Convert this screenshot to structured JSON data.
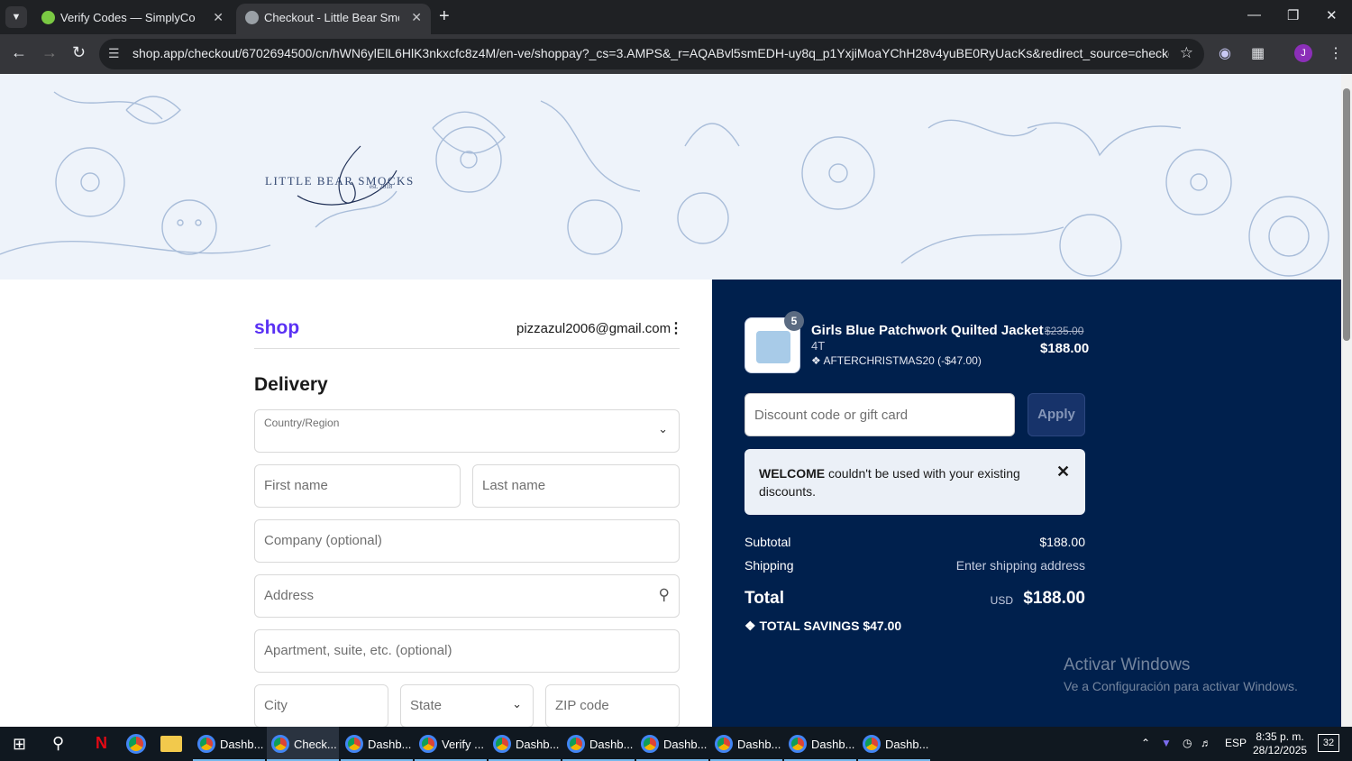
{
  "browser": {
    "tabs": [
      {
        "title": "Verify Codes — SimplyCodes",
        "active": false
      },
      {
        "title": "Checkout - Little Bear Smocks",
        "active": true
      }
    ],
    "url": "shop.app/checkout/6702694500/cn/hWN6ylElL6HlK3nkxcfc8z4M/en-ve/shoppay?_cs=3.AMPS&_r=AQABvl5smEDH-uy8q_p1YxjiMoaYChH28v4yuBE0RyUacKs&redirect_source=checkout_automatic...",
    "avatar_initial": "J"
  },
  "store": {
    "logo_text": "LITTLE BEAR SMOCKS",
    "logo_est": "est. 2018"
  },
  "checkout": {
    "shop_logo": "shop",
    "email": "pizzazul2006@gmail.com",
    "section_title": "Delivery",
    "fields": {
      "country": "Country/Region",
      "first_name": "First name",
      "last_name": "Last name",
      "company": "Company (optional)",
      "address": "Address",
      "apartment": "Apartment, suite, etc. (optional)",
      "city": "City",
      "state": "State",
      "zip": "ZIP code"
    }
  },
  "summary": {
    "item": {
      "quantity": "5",
      "name": "Girls Blue Patchwork Quilted Jacket",
      "variant": "4T",
      "discount": "AFTERCHRISTMAS20 (-$47.00)",
      "price_original": "$235.00",
      "price": "$188.00"
    },
    "discount_placeholder": "Discount code or gift card",
    "apply_label": "Apply",
    "notice": {
      "code": "WELCOME",
      "message": " couldn't be used with your existing discounts."
    },
    "subtotal_label": "Subtotal",
    "subtotal_value": "$188.00",
    "shipping_label": "Shipping",
    "shipping_value": "Enter shipping address",
    "total_label": "Total",
    "total_currency": "USD",
    "total_value": "$188.00",
    "savings_label": "TOTAL SAVINGS",
    "savings_value": "$47.00"
  },
  "watermark": {
    "line1": "Activar Windows",
    "line2": "Ve a Configuración para activar Windows."
  },
  "taskbar": {
    "apps": [
      "Dashb...",
      "Check...",
      "Dashb...",
      "Verify ...",
      "Dashb...",
      "Dashb...",
      "Dashb...",
      "Dashb...",
      "Dashb...",
      "Dashb..."
    ],
    "language": "ESP",
    "time": "8:35 p. m.",
    "date": "28/12/2025",
    "notifications": "32"
  }
}
